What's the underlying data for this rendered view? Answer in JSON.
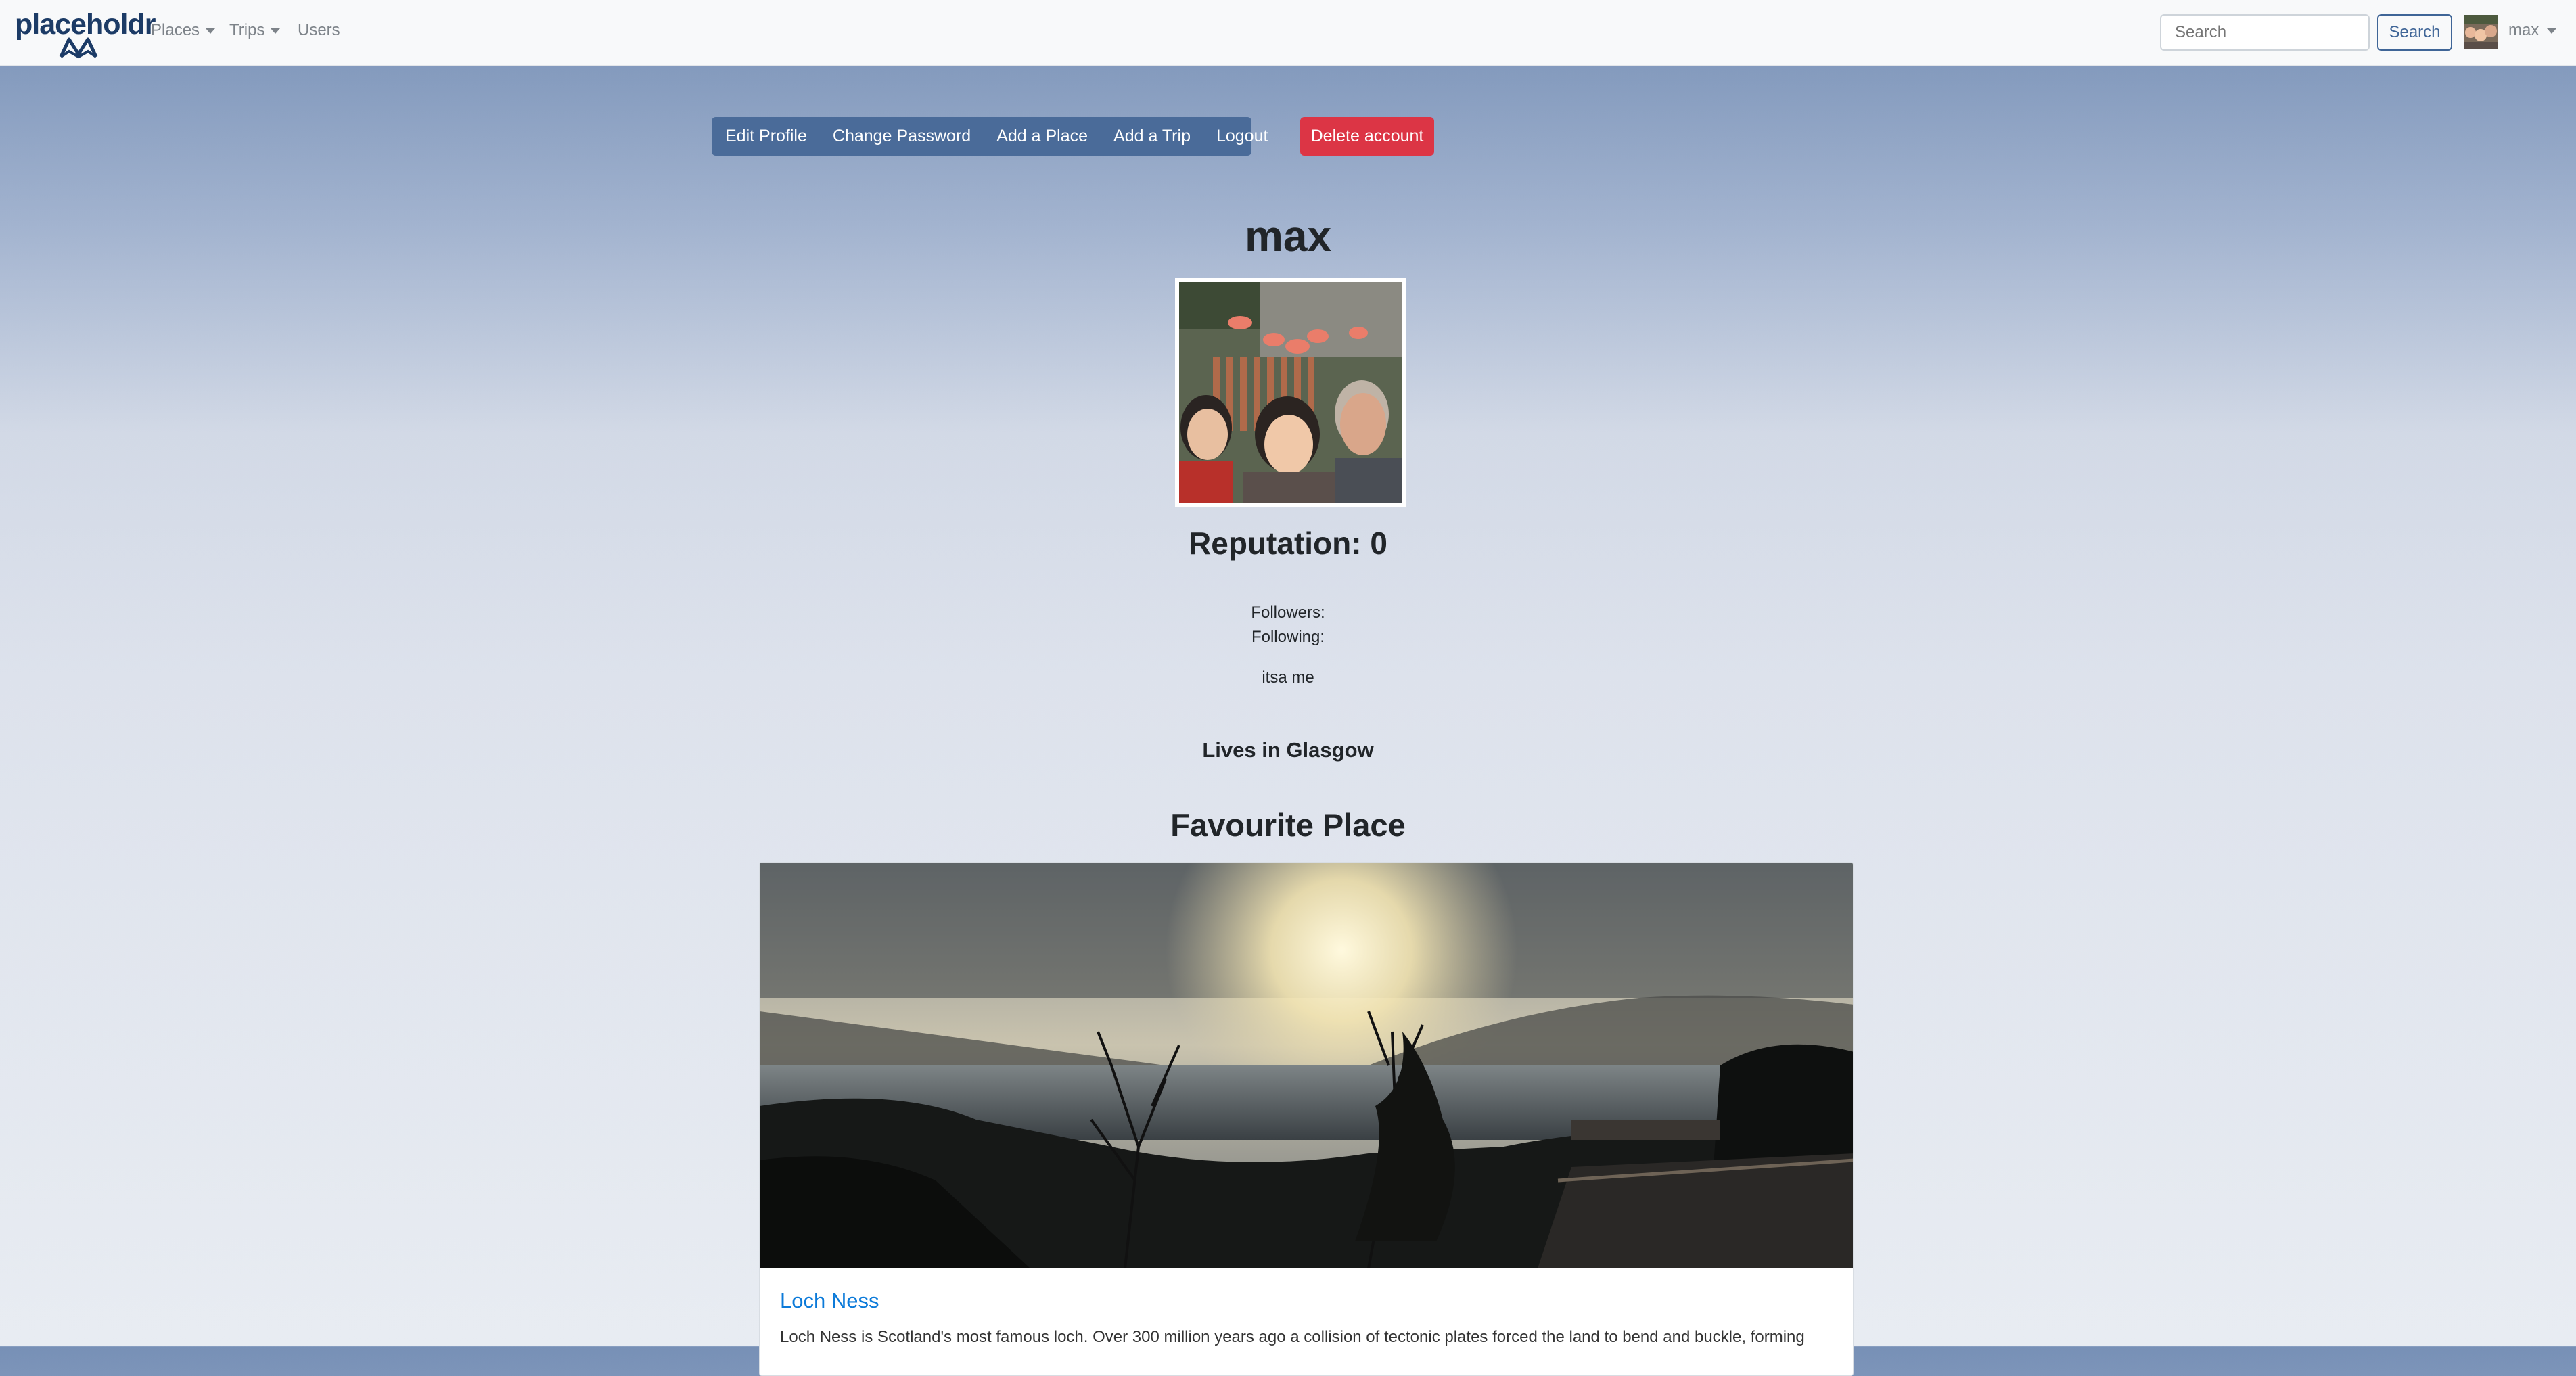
{
  "navbar": {
    "brand": "placeholdr",
    "places": "Places",
    "trips": "Trips",
    "users": "Users",
    "search_placeholder": "Search",
    "search_button": "Search",
    "user": "max"
  },
  "actions": {
    "edit_profile": "Edit Profile",
    "change_password": "Change Password",
    "add_place": "Add a Place",
    "add_trip": "Add a Trip",
    "logout": "Logout",
    "delete_account": "Delete account"
  },
  "profile": {
    "username": "max",
    "reputation": "Reputation: 0",
    "followers": "Followers:",
    "following": "Following:",
    "bio": "itsa me",
    "lives": "Lives in Glasgow"
  },
  "favourite": {
    "heading": "Favourite Place",
    "place_name": "Loch Ness",
    "description": "Loch Ness is Scotland's most famous loch. Over 300 million years ago a collision of tectonic plates forced the land to bend and buckle, forming"
  }
}
